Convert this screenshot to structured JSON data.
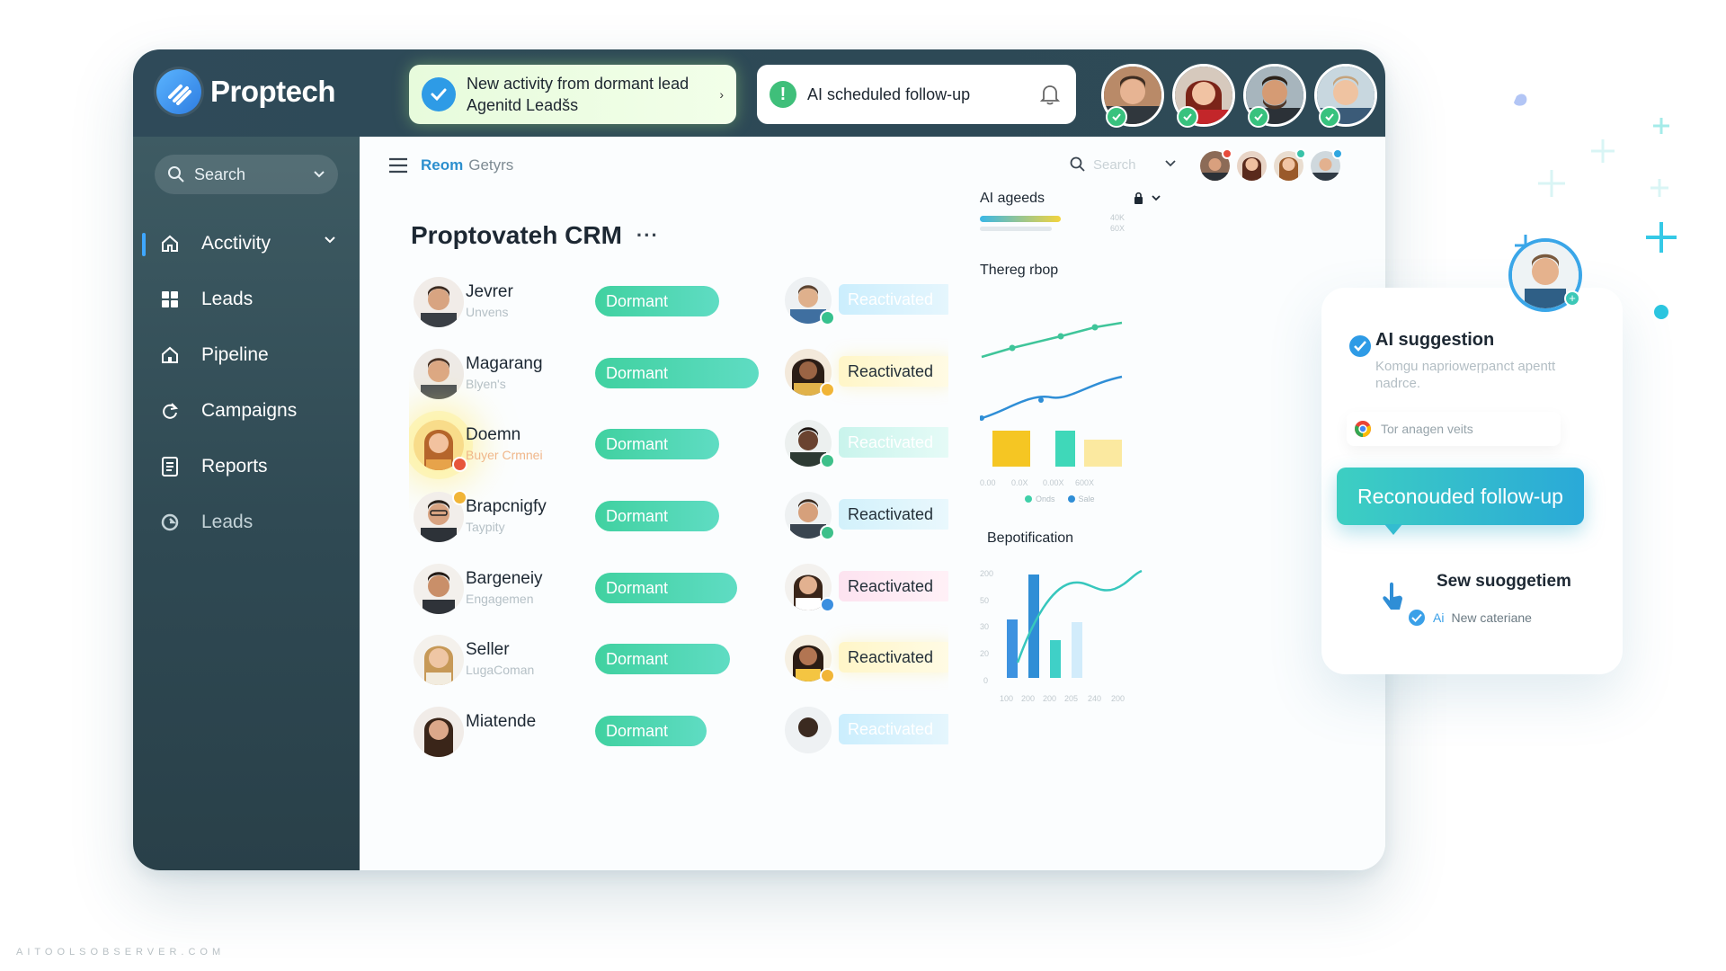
{
  "app": {
    "name": "Proptech"
  },
  "notifications": [
    {
      "line1": "New activity from dormant lead",
      "line2": "Agenitd Leadšs",
      "icon": "check-icon"
    },
    {
      "text": "AI scheduled follow-up",
      "icon": "warning-icon"
    }
  ],
  "sidebar": {
    "search_label": "Search",
    "items": [
      {
        "label": "Acctivity",
        "icon": "home-icon"
      },
      {
        "label": "Leads",
        "icon": "grid-icon"
      },
      {
        "label": "Pipeline",
        "icon": "home-outline-icon"
      },
      {
        "label": "Campaigns",
        "icon": "refresh-icon"
      },
      {
        "label": "Reports",
        "icon": "document-icon"
      },
      {
        "label": "Leads",
        "icon": "refresh-circle-icon"
      }
    ]
  },
  "header": {
    "breadcrumb_primary": "Reom",
    "breadcrumb_secondary": "Getyrs",
    "search_placeholder": "Search"
  },
  "page": {
    "title": "Proptovateh CRM",
    "more": "···"
  },
  "leads": [
    {
      "name": "Jevrer",
      "subtitle": "Unvens",
      "status": "Dormant",
      "state": "Reactivated"
    },
    {
      "name": "Magarang",
      "subtitle": "Blyen's",
      "status": "Dormant",
      "state": "Reactivated"
    },
    {
      "name": "Doemn",
      "subtitle": "Buyer Crmnei",
      "status": "Dormant",
      "state": "Reactivated"
    },
    {
      "name": "Brapcnigfy",
      "subtitle": "Taypity",
      "status": "Dormant",
      "state": "Reactivated"
    },
    {
      "name": "Bargeneiy",
      "subtitle": "Engagemen",
      "status": "Dormant",
      "state": "Reactivated"
    },
    {
      "name": "Seller",
      "subtitle": "LugaComan",
      "status": "Dormant",
      "state": "Reactivated"
    },
    {
      "name": "Miatende",
      "subtitle": "",
      "status": "Dormant",
      "state": "Reactivated"
    }
  ],
  "panel": {
    "ai_label": "AI ageeds",
    "ai_axis": [
      "40K",
      "60X"
    ],
    "section2": "Thereg rbop",
    "mid_axis": [
      "0.00",
      "0.0X",
      "0.00X",
      "600X"
    ],
    "legend": [
      "Onds",
      "Sale"
    ],
    "section3": "Bepotification",
    "bottom_y": [
      "200",
      "50",
      "30",
      "20",
      "0"
    ],
    "bottom_x": [
      "100",
      "200",
      "200",
      "205",
      "240",
      "200"
    ]
  },
  "ai_card": {
    "title": "AI suggestion",
    "body": "Komgu naprioweŗpanct apentt nadrce.",
    "source": "Tor anagen veits",
    "button": "Reconouded follow-up",
    "sub_title": "Sew suoggetiem",
    "sub_prefix": "Ai",
    "sub_text": "New cateriane"
  },
  "watermark": "AITOOLSOBSERVER.COM",
  "colors": {
    "accent": "#2c8fce",
    "dormant": "#40d1a0",
    "sidebar": "#2f4953",
    "topbar": "#2d4956"
  }
}
